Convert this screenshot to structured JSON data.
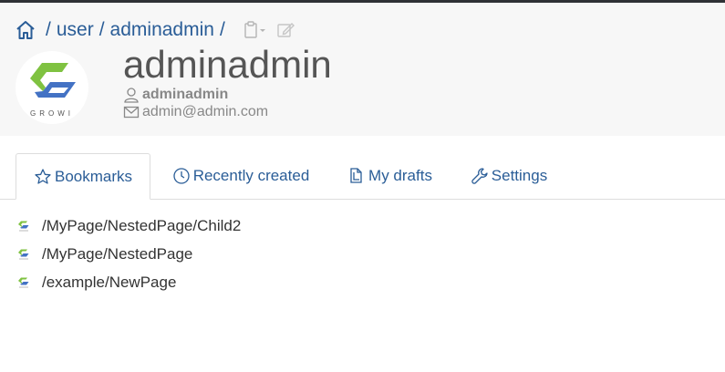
{
  "breadcrumb": {
    "separator": "/",
    "segments": [
      "user",
      "adminadmin"
    ]
  },
  "profile": {
    "display_name": "adminadmin",
    "username": "adminadmin",
    "email": "admin@admin.com",
    "avatar_text": "GROWI",
    "brand_colors": {
      "green": "#7fc241",
      "blue": "#4372c4"
    }
  },
  "tabs": [
    {
      "label": "Bookmarks",
      "icon": "star-icon",
      "active": true
    },
    {
      "label": "Recently created",
      "icon": "clock-icon",
      "active": false
    },
    {
      "label": "My drafts",
      "icon": "document-icon",
      "active": false
    },
    {
      "label": "Settings",
      "icon": "wrench-icon",
      "active": false
    }
  ],
  "bookmarks": [
    "/MyPage/NestedPage/Child2",
    "/MyPage/NestedPage",
    "/example/NewPage"
  ],
  "colors": {
    "link": "#2a5d97",
    "header_bg": "#f7f7f7"
  }
}
